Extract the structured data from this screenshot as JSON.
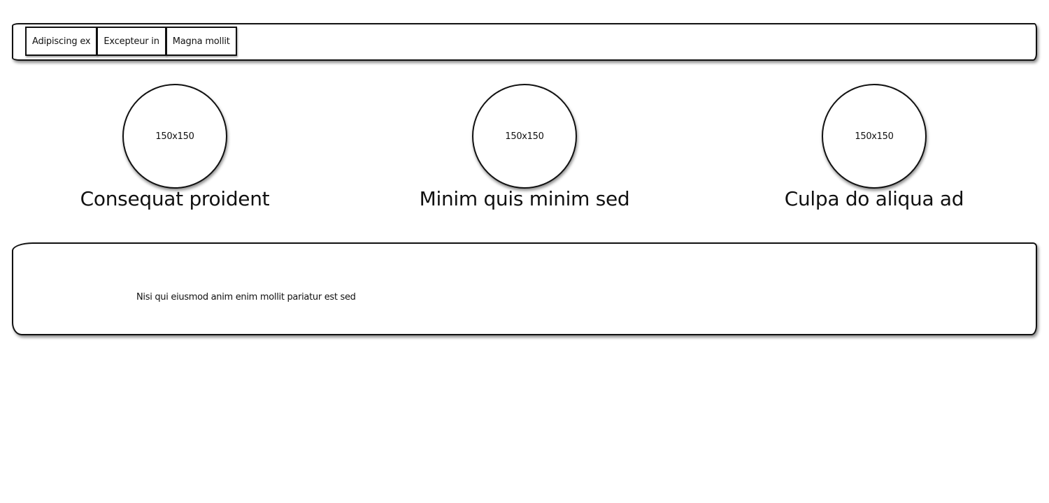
{
  "navbar": {
    "buttons": [
      {
        "label": "Adipiscing ex"
      },
      {
        "label": "Excepteur in"
      },
      {
        "label": "Magna mollit"
      }
    ]
  },
  "features": [
    {
      "image_label": "150x150",
      "title": "Consequat proident"
    },
    {
      "image_label": "150x150",
      "title": "Minim quis minim sed"
    },
    {
      "image_label": "150x150",
      "title": "Culpa do aliqua ad"
    }
  ],
  "content": {
    "text": "Nisi qui eiusmod anim enim mollit pariatur est sed"
  }
}
